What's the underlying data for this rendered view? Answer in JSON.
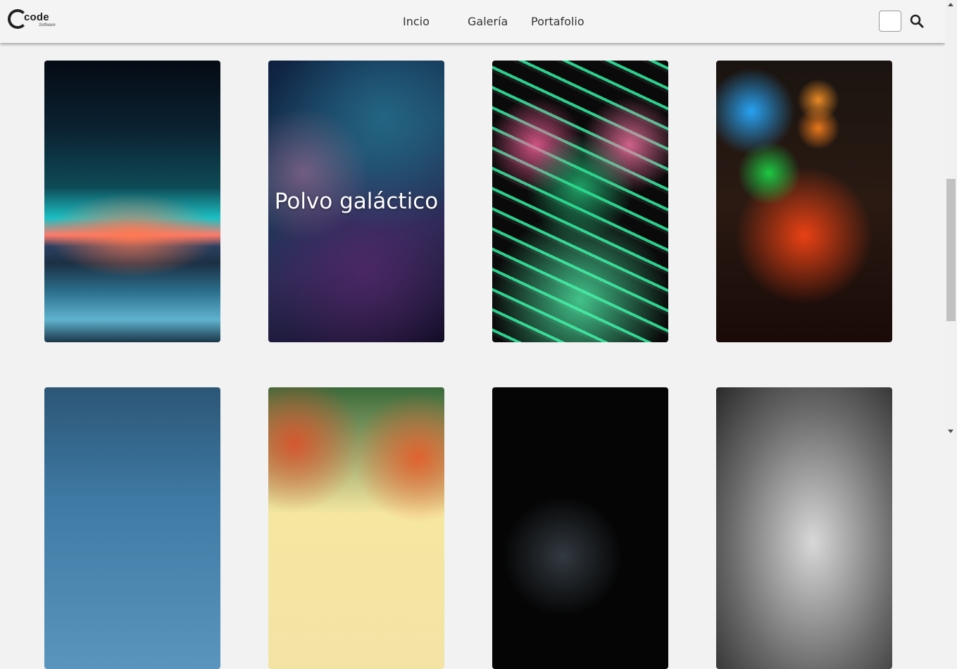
{
  "brand": {
    "logo_text": "code",
    "logo_subtext": "Software"
  },
  "nav": {
    "links": [
      {
        "label": "Incio"
      },
      {
        "label": "Galería"
      },
      {
        "label": "Portafolio"
      }
    ]
  },
  "search": {
    "value": "",
    "icon": "search-icon"
  },
  "gallery": {
    "rows": [
      {
        "cards": [
          {
            "image": "mountain-sunset",
            "caption": ""
          },
          {
            "image": "galaxy-nebula",
            "caption": "Polvo galáctico"
          },
          {
            "image": "neon-tiger",
            "caption": ""
          },
          {
            "image": "rain-bokeh-lights",
            "caption": ""
          }
        ]
      },
      {
        "cards": [
          {
            "image": "blue-sky",
            "caption": ""
          },
          {
            "image": "autumn-forest",
            "caption": ""
          },
          {
            "image": "dark-scene",
            "caption": ""
          },
          {
            "image": "grayscale-face",
            "caption": ""
          }
        ]
      }
    ]
  }
}
